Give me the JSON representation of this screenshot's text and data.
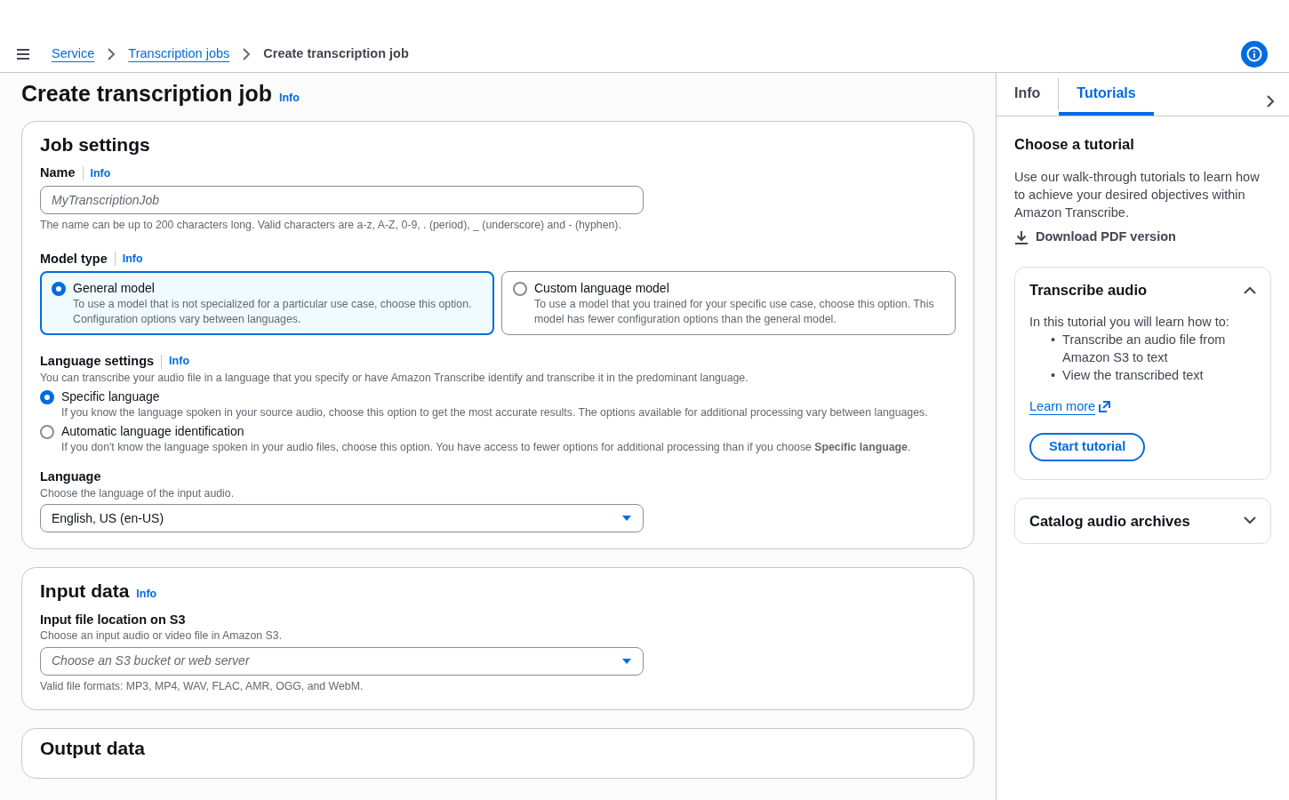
{
  "breadcrumbs": [
    {
      "label": "Service",
      "kind": "link"
    },
    {
      "label": "Transcription jobs",
      "kind": "link"
    },
    {
      "label": "Create transcription job",
      "kind": "current"
    }
  ],
  "page": {
    "title": "Create transcription job",
    "info": "Info"
  },
  "job_settings": {
    "title": "Job settings",
    "name_field": {
      "label": "Name",
      "info": "Info",
      "placeholder": "MyTranscriptionJob",
      "hint": "The name can be up to 200 characters long. Valid characters are a-z, A-Z, 0-9, . (period), _ (underscore) and - (hyphen)."
    },
    "model_type": {
      "label": "Model type",
      "info": "Info",
      "options": [
        {
          "title": "General model",
          "description": "To use a model that is not specialized for a particular use case, choose this option. Configuration options vary between languages.",
          "selected": true
        },
        {
          "title": "Custom language model",
          "description": "To use a model that you trained for your specific use case, choose this option. This model has fewer configuration options than the general model.",
          "selected": false
        }
      ]
    },
    "language_settings": {
      "label": "Language settings",
      "info": "Info",
      "description": "You can transcribe your audio file in a language that you specify or have Amazon Transcribe identify and transcribe it in the predominant language.",
      "options": [
        {
          "title": "Specific language",
          "description": "If you know the language spoken in your source audio, choose this option to get the most accurate results. The options available for additional processing vary between languages.",
          "selected": true
        },
        {
          "title": "Automatic language identification",
          "description": "If you don't know the language spoken in your audio files, choose this option. You have access to fewer options for additional processing than if you choose **Specific language**.",
          "selected": false
        }
      ]
    },
    "language": {
      "label": "Language",
      "description": "Choose the language of the input audio.",
      "value": "English, US (en-US)"
    }
  },
  "input_data": {
    "title": "Input data",
    "info": "Info",
    "field": {
      "label": "Input file location on S3",
      "description": "Choose an input audio or video file in Amazon S3.",
      "placeholder": "Choose an S3 bucket or web server",
      "hint": "Valid file formats: MP3, MP4, WAV, FLAC, AMR, OGG, and WebM."
    }
  },
  "output_data": {
    "title": "Output data"
  },
  "side_panel": {
    "tabs": [
      {
        "label": "Info",
        "selected": false
      },
      {
        "label": "Tutorials",
        "selected": true
      }
    ],
    "heading": "Choose a tutorial",
    "description": "Use our walk-through tutorials to learn how to achieve your desired objectives within Amazon Transcribe.",
    "download": "Download PDF version",
    "sections": [
      {
        "title": "Transcribe audio",
        "expanded": true,
        "intro": "In this tutorial you will learn how to:",
        "marker": "•",
        "bullets": [
          "Transcribe an audio file from Amazon S3 to text",
          "View the transcribed text"
        ],
        "link": "Learn more",
        "button": "Start tutorial"
      },
      {
        "title": "Catalog audio archives",
        "expanded": false
      }
    ]
  }
}
